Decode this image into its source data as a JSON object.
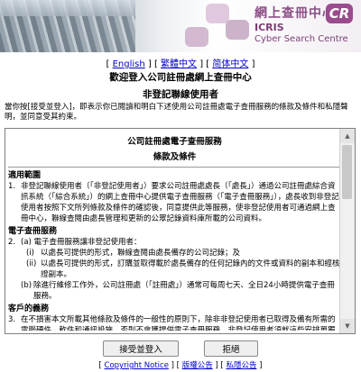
{
  "header": {
    "logo_zh": "網上查冊中心",
    "logo_abbr": "CR",
    "logo_icris": "ICRIS",
    "logo_en": "Cyber Search Centre"
  },
  "lang": {
    "english": "English",
    "traditional": "繁體中文",
    "simplified": "简体中文"
  },
  "welcome": "歡迎登入公司註冊處網上查冊中心",
  "user_type": "非登記聯線使用者",
  "intro": "當你按[接受並登入]，即表示你已閱讀和明白下述使用公司註冊處電子查冊服務的條款及條件和私隱聲明，並同意受其約束。",
  "terms": {
    "title": "公司註冊處電子查冊服務",
    "subtitle": "條款及條件",
    "sections": [
      {
        "heading": "適用範圍",
        "paras": [
          {
            "num": "1.",
            "text": "非登記聯線使用者（「非登記使用者」）要求公司註冊處處長（「處長」）通過公司註冊處綜合資訊系統（「綜合系統」）的網上查冊中心提供電子查冊服務（「電子查冊服務」），處長收到非登記使用者按照下文所列條款及條件的確認後，同意提供此等服務，使非登記使用者可通過網上查冊中心，聯線查閱由處長管理和更新的公眾記錄資料庫所載的公司資料。"
          }
        ]
      },
      {
        "heading": "電子查冊服務",
        "paras": [
          {
            "num": "2.",
            "text": "(a)  電子查冊服務讓非登記使用者："
          },
          {
            "sub": "(i)",
            "text": "以處長可提供的形式，聯線查閱由處長備存的公司記錄；及"
          },
          {
            "sub": "(ii)",
            "text": "以處長可提供的形式，訂購並取得載於處長備存的任何記錄內的文件或資料的副本和經核證副本。"
          },
          {
            "sub": "(b)",
            "text": "除進行維修工作外，公司註冊處（「註冊處」）通常可每周七天、全日24小時提供電子查冊服務。"
          }
        ]
      },
      {
        "heading": "客戶的義務",
        "paras": [
          {
            "num": "3.",
            "text": "在不損害本文所載其他條款及條件的一般性的原則下，除非非登記使用者已取得及備有所需的電腦硬件、軟件和通訊設施，否則不會獲提供電子查冊服務。非登記使用者須就這些安排單獨負責，並確保有關的電腦硬件、軟件、網絡和通訊設施，在處長所訂定合適及完善的條件下可以使用，以免處長不會就非登記使用者未能取得或運用所需電腦硬件、軟件、網絡或通訊設施負責。"
          }
        ]
      }
    ]
  },
  "buttons": {
    "accept": "接受並登入",
    "reject": "拒絕"
  },
  "footer": {
    "copyright": "Copyright Notice",
    "copyright_zh": "版權公告",
    "privacy": "私隱公告"
  }
}
